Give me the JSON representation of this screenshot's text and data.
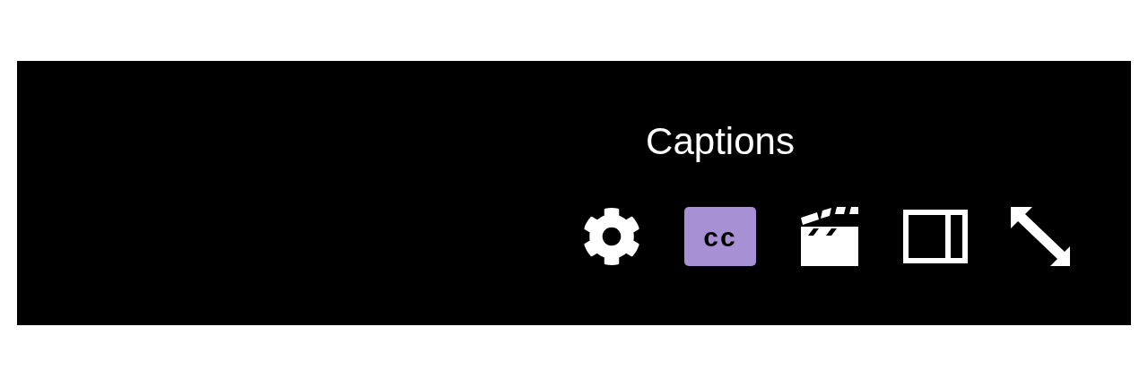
{
  "player_controls": {
    "buttons": [
      {
        "kind": "settings",
        "on": false
      },
      {
        "kind": "captions",
        "label": "cc",
        "on": true,
        "tooltip": "Captions"
      },
      {
        "kind": "clip",
        "on": false
      },
      {
        "kind": "theater",
        "on": false
      },
      {
        "kind": "fullscreen",
        "on": false
      }
    ]
  }
}
